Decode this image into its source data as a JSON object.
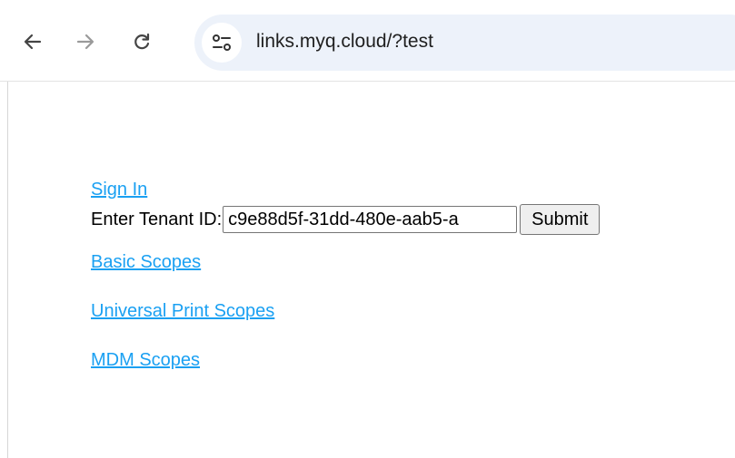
{
  "browser": {
    "url": "links.myq.cloud/?test",
    "back_icon": "arrow-left-icon",
    "forward_icon": "arrow-right-icon",
    "reload_icon": "reload-icon",
    "site_info_icon": "tune-icon"
  },
  "page": {
    "sign_in_label": "Sign In",
    "tenant_label": "Enter Tenant ID:",
    "tenant_value": "c9e88d5f-31dd-480e-aab5-a",
    "submit_label": "Submit",
    "links": [
      {
        "label": "Basic Scopes"
      },
      {
        "label": "Universal Print Scopes"
      },
      {
        "label": "MDM Scopes"
      }
    ],
    "link_color": "#1aa0f2"
  }
}
